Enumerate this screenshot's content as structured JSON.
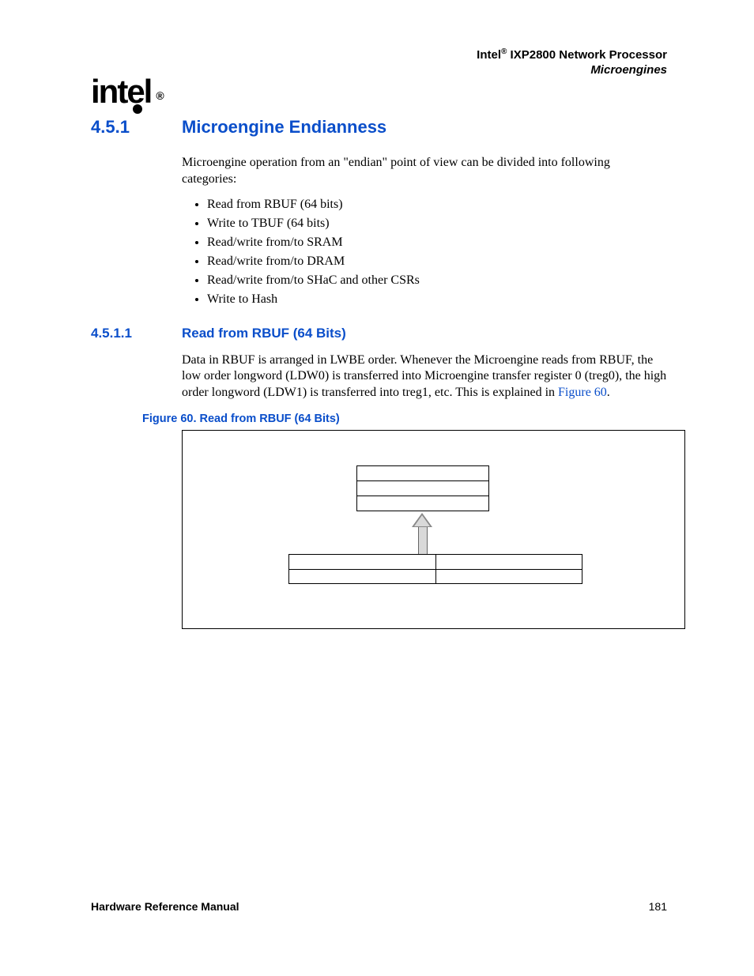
{
  "header": {
    "brand": "Intel",
    "reg": "®",
    "product": " IXP2800 Network Processor",
    "section": "Microengines"
  },
  "logo": {
    "text": "intel",
    "reg": "®"
  },
  "h2": {
    "num": "4.5.1",
    "title": "Microengine Endianness"
  },
  "intro": "Microengine operation from an \"endian\" point of view can be divided into following categories:",
  "bullets": [
    "Read from RBUF (64 bits)",
    "Write to TBUF (64 bits)",
    "Read/write from/to SRAM",
    "Read/write from/to DRAM",
    "Read/write from/to SHaC and other CSRs",
    "Write to Hash"
  ],
  "h3": {
    "num": "4.5.1.1",
    "title": "Read from RBUF (64 Bits)"
  },
  "para451_1_a": "Data in RBUF is arranged in LWBE order. Whenever the Microengine reads from RBUF, the low order longword (LDW0) is transferred into Microengine transfer register 0 (treg0), the high order longword (LDW1) is transferred into treg1, etc. This is explained in ",
  "para451_1_link": "Figure 60",
  "para451_1_b": ".",
  "figcap": "Figure 60. Read from RBUF (64 Bits)",
  "footer": {
    "label": "Hardware Reference Manual",
    "page": "181"
  }
}
